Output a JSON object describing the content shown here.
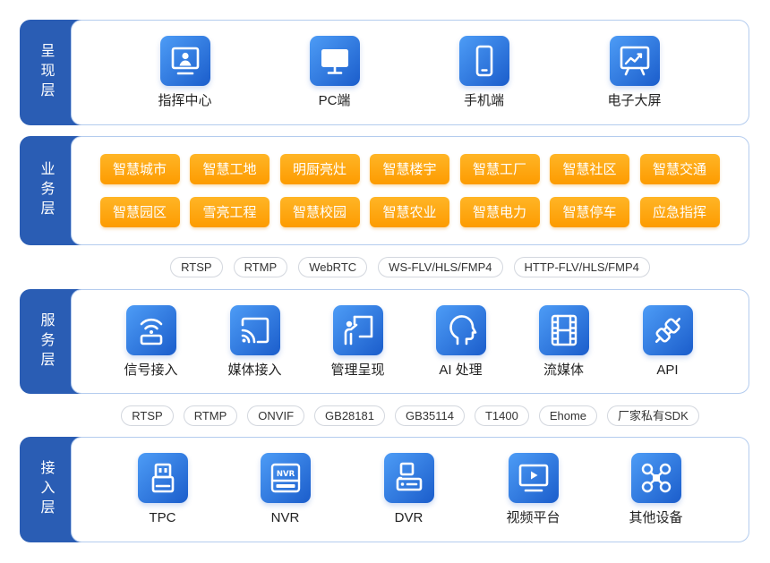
{
  "colors": {
    "tab_blue": "#2a5db4",
    "panel_border": "#b4ccee",
    "icon_gradient_start": "#4d9cf6",
    "icon_gradient_end": "#1b5dcb",
    "business_tag_top": "#ffb526",
    "business_tag_bottom": "#fd9b00",
    "pill_border": "#d3d7de"
  },
  "presentation_layer": {
    "label": "呈现层",
    "items": [
      {
        "label": "指挥中心",
        "icon": "command-center-icon"
      },
      {
        "label": "PC端",
        "icon": "pc-icon"
      },
      {
        "label": "手机端",
        "icon": "mobile-icon"
      },
      {
        "label": "电子大屏",
        "icon": "big-screen-icon"
      }
    ]
  },
  "business_layer": {
    "label": "业务层",
    "items": [
      "智慧城市",
      "智慧工地",
      "明厨亮灶",
      "智慧楼宇",
      "智慧工厂",
      "智慧社区",
      "智慧交通",
      "智慧园区",
      "雪亮工程",
      "智慧校园",
      "智慧农业",
      "智慧电力",
      "智慧停车",
      "应急指挥"
    ]
  },
  "upper_protocols": [
    "RTSP",
    "RTMP",
    "WebRTC",
    "WS-FLV/HLS/FMP4",
    "HTTP-FLV/HLS/FMP4"
  ],
  "service_layer": {
    "label": "服务层",
    "items": [
      {
        "label": "信号接入",
        "icon": "signal-icon"
      },
      {
        "label": "媒体接入",
        "icon": "cast-icon"
      },
      {
        "label": "管理呈现",
        "icon": "presenter-icon"
      },
      {
        "label": "AI 处理",
        "icon": "ai-head-icon"
      },
      {
        "label": "流媒体",
        "icon": "film-icon"
      },
      {
        "label": "API",
        "icon": "plug-icon"
      }
    ]
  },
  "lower_protocols": [
    "RTSP",
    "RTMP",
    "ONVIF",
    "GB28181",
    "GB35114",
    "T1400",
    "Ehome",
    "厂家私有SDK"
  ],
  "access_layer": {
    "label": "接入层",
    "items": [
      {
        "label": "TPC",
        "icon": "tpc-icon"
      },
      {
        "label": "NVR",
        "icon": "nvr-icon",
        "icon_text": "NVR"
      },
      {
        "label": "DVR",
        "icon": "dvr-icon"
      },
      {
        "label": "视频平台",
        "icon": "video-platform-icon"
      },
      {
        "label": "其他设备",
        "icon": "drone-icon"
      }
    ]
  }
}
